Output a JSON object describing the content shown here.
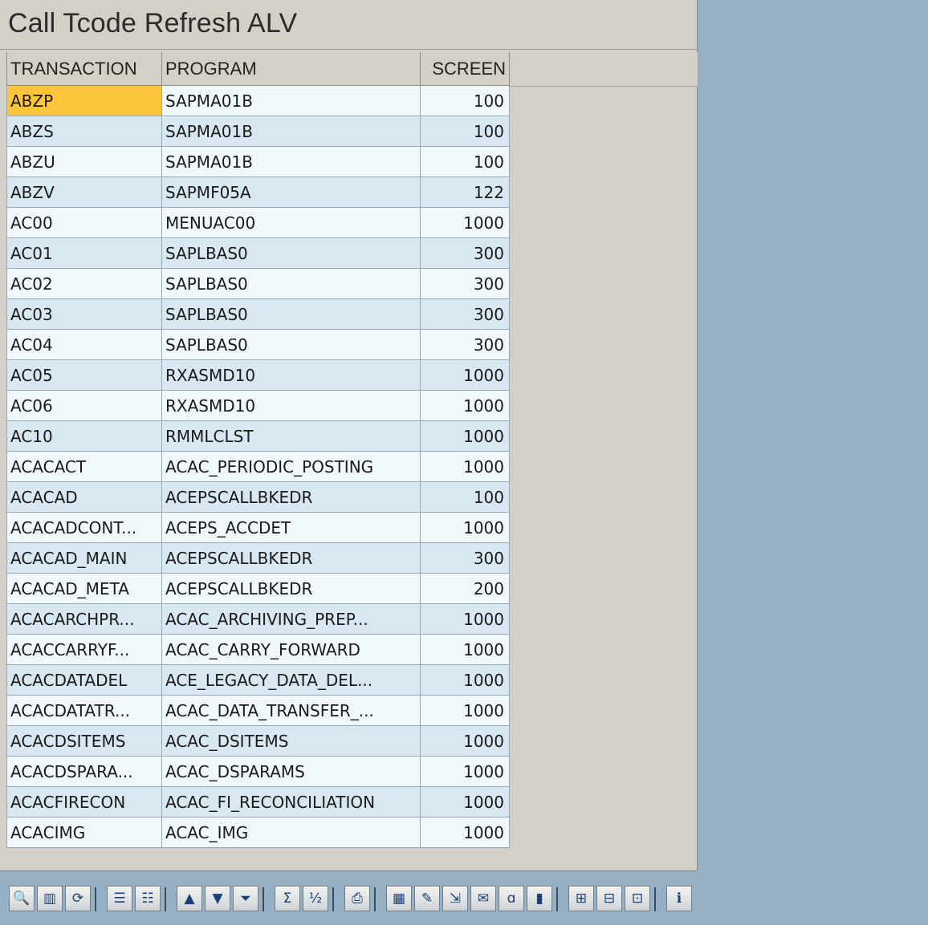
{
  "title": "Call Tcode Refresh ALV",
  "columns": [
    "TRANSACTION",
    "PROGRAM",
    "SCREEN"
  ],
  "rows": [
    {
      "transaction": "ABZP",
      "program": "SAPMA01B",
      "screen": "100",
      "selected": true
    },
    {
      "transaction": "ABZS",
      "program": "SAPMA01B",
      "screen": "100"
    },
    {
      "transaction": "ABZU",
      "program": "SAPMA01B",
      "screen": "100"
    },
    {
      "transaction": "ABZV",
      "program": "SAPMF05A",
      "screen": "122"
    },
    {
      "transaction": "AC00",
      "program": "MENUAC00",
      "screen": "1000"
    },
    {
      "transaction": "AC01",
      "program": "SAPLBAS0",
      "screen": "300"
    },
    {
      "transaction": "AC02",
      "program": "SAPLBAS0",
      "screen": "300"
    },
    {
      "transaction": "AC03",
      "program": "SAPLBAS0",
      "screen": "300"
    },
    {
      "transaction": "AC04",
      "program": "SAPLBAS0",
      "screen": "300"
    },
    {
      "transaction": "AC05",
      "program": "RXASMD10",
      "screen": "1000"
    },
    {
      "transaction": "AC06",
      "program": "RXASMD10",
      "screen": "1000"
    },
    {
      "transaction": "AC10",
      "program": "RMMLCLST",
      "screen": "1000"
    },
    {
      "transaction": "ACACACT",
      "program": "ACAC_PERIODIC_POSTING",
      "screen": "1000"
    },
    {
      "transaction": "ACACAD",
      "program": "ACEPSCALLBKEDR",
      "screen": "100"
    },
    {
      "transaction": "ACACADCONT...",
      "program": "ACEPS_ACCDET",
      "screen": "1000"
    },
    {
      "transaction": "ACACAD_MAIN",
      "program": "ACEPSCALLBKEDR",
      "screen": "300"
    },
    {
      "transaction": "ACACAD_META",
      "program": "ACEPSCALLBKEDR",
      "screen": "200"
    },
    {
      "transaction": "ACACARCHPR...",
      "program": "ACAC_ARCHIVING_PREP...",
      "screen": "1000"
    },
    {
      "transaction": "ACACCARRYF...",
      "program": "ACAC_CARRY_FORWARD",
      "screen": "1000"
    },
    {
      "transaction": "ACACDATADEL",
      "program": "ACE_LEGACY_DATA_DEL...",
      "screen": "1000"
    },
    {
      "transaction": "ACACDATATR...",
      "program": "ACAC_DATA_TRANSFER_...",
      "screen": "1000"
    },
    {
      "transaction": "ACACDSITEMS",
      "program": "ACAC_DSITEMS",
      "screen": "1000"
    },
    {
      "transaction": "ACACDSPARA...",
      "program": "ACAC_DSPARAMS",
      "screen": "1000"
    },
    {
      "transaction": "ACACFIRECON",
      "program": "ACAC_FI_RECONCILIATION",
      "screen": "1000"
    },
    {
      "transaction": "ACACIMG",
      "program": "ACAC_IMG",
      "screen": "1000"
    }
  ],
  "toolbar": [
    {
      "name": "details-icon",
      "glyph": "🔍"
    },
    {
      "name": "layout-columns-icon",
      "glyph": "▥"
    },
    {
      "name": "refresh-icon",
      "glyph": "⟳"
    },
    {
      "sep": true
    },
    {
      "name": "select-all-icon",
      "glyph": "☰"
    },
    {
      "name": "deselect-all-icon",
      "glyph": "☷"
    },
    {
      "sep": true
    },
    {
      "name": "sort-ascending-icon",
      "glyph": "▲"
    },
    {
      "name": "sort-descending-icon",
      "glyph": "▼"
    },
    {
      "name": "filter-icon",
      "glyph": "⏷"
    },
    {
      "sep": true
    },
    {
      "name": "sum-icon",
      "glyph": "Σ"
    },
    {
      "name": "subtotals-icon",
      "glyph": "½"
    },
    {
      "sep": true
    },
    {
      "name": "print-preview-icon",
      "glyph": "⎙"
    },
    {
      "sep": true
    },
    {
      "name": "export-spreadsheet-icon",
      "glyph": "▦"
    },
    {
      "name": "word-processing-icon",
      "glyph": "✎"
    },
    {
      "name": "local-file-icon",
      "glyph": "⇲"
    },
    {
      "name": "send-mail-icon",
      "glyph": "✉"
    },
    {
      "name": "abc-analysis-icon",
      "glyph": "ɑ"
    },
    {
      "name": "graphic-icon",
      "glyph": "▮"
    },
    {
      "sep": true
    },
    {
      "name": "change-layout-icon",
      "glyph": "⊞"
    },
    {
      "name": "choose-layout-icon",
      "glyph": "⊟"
    },
    {
      "name": "save-layout-icon",
      "glyph": "⊡"
    },
    {
      "sep": true
    },
    {
      "name": "information-icon",
      "glyph": "ℹ"
    }
  ]
}
